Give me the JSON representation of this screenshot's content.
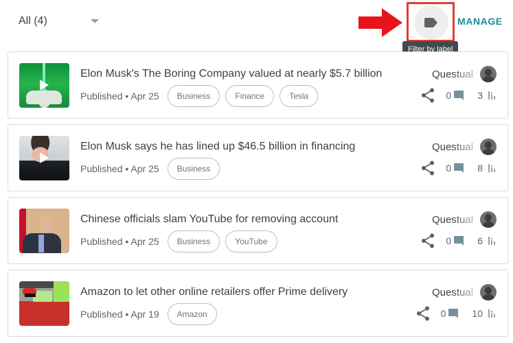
{
  "toolbar": {
    "filter_label": "All (4)",
    "filter_icon": "chevron-down-icon",
    "label_button_icon": "label-icon",
    "manage_label": "MANAGE",
    "tooltip": "Filter by label",
    "annotation": {
      "arrow_icon": "arrow-right-icon",
      "arrow_color": "#e8141c",
      "box_color": "#e53935"
    },
    "accent_color": "#1a8a9a"
  },
  "items": [
    {
      "title": "Elon Musk's The Boring Company valued at nearly $5.7 billion",
      "published": "Published • Apr 25",
      "tags": [
        "Business",
        "Finance",
        "Tesla"
      ],
      "author": "Questual",
      "comments": "0",
      "views": "3",
      "thumbnail": "green-tesla-car-video",
      "has_video": true
    },
    {
      "title": "Elon Musk says he has lined up $46.5 billion in financing",
      "published": "Published • Apr 25",
      "tags": [
        "Business"
      ],
      "author": "Questual",
      "comments": "0",
      "views": "8",
      "thumbnail": "elon-musk-portrait-video",
      "has_video": true
    },
    {
      "title": "Chinese officials slam YouTube for removing account",
      "published": "Published • Apr 25",
      "tags": [
        "Business",
        "YouTube"
      ],
      "author": "Questual",
      "comments": "0",
      "views": "6",
      "thumbnail": "official-speaking-photo",
      "has_video": false
    },
    {
      "title": "Amazon to let other online retailers offer Prime delivery",
      "published": "Published • Apr 19",
      "tags": [
        "Amazon"
      ],
      "author": "Questual",
      "comments": "0",
      "views": "10",
      "thumbnail": "protest-crowd-photo",
      "has_video": false
    }
  ]
}
